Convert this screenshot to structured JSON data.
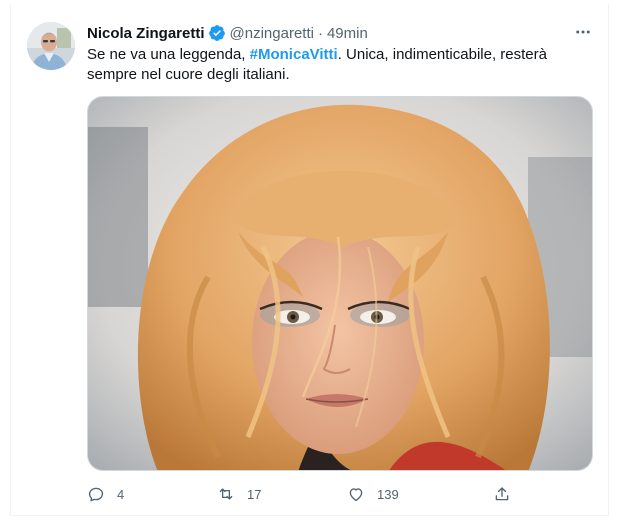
{
  "tweet": {
    "author_name": "Nicola Zingaretti",
    "handle": "@nzingaretti",
    "separator": "·",
    "timestamp": "49min",
    "text_before": "Se ne va una leggenda, ",
    "hashtag": "#MonicaVitti",
    "text_after": ". Unica, indimenticabile, resterà sempre nel cuore degli italiani."
  },
  "actions": {
    "reply_count": "4",
    "retweet_count": "17",
    "like_count": "139"
  },
  "colors": {
    "accent": "#1d9bf0",
    "text_primary": "#0f1419",
    "text_secondary": "#536471"
  },
  "icons": {
    "verified": "verified-badge-icon",
    "more": "more-options-icon",
    "reply": "reply-icon",
    "retweet": "retweet-icon",
    "like": "heart-icon",
    "share": "share-icon"
  }
}
